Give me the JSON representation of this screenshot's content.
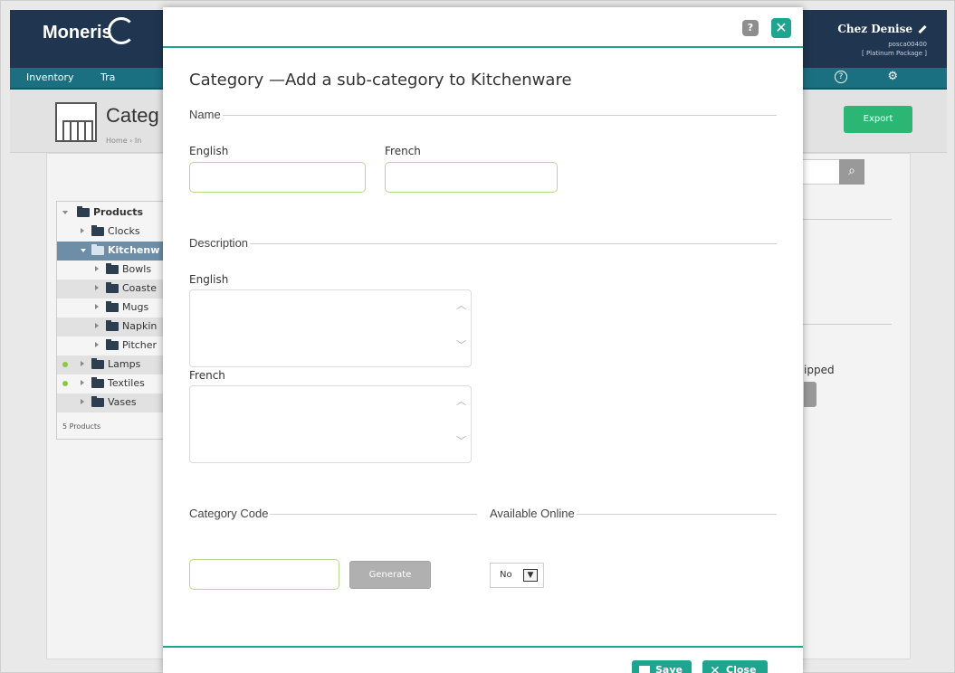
{
  "app": {
    "logo_text": "Moneris",
    "store_name": "Chez Denise",
    "store_code": "posca00400",
    "store_package": "[ Platinum Package ]"
  },
  "nav": {
    "items": [
      "Inventory",
      "Tra"
    ]
  },
  "page": {
    "title": "Categ",
    "breadcrumb": "Home  ›  In",
    "export_label": "Export"
  },
  "tree": {
    "items": [
      {
        "label": "Products",
        "level": 0
      },
      {
        "label": "Clocks",
        "level": 1
      },
      {
        "label": "Kitchenw",
        "level": 1
      },
      {
        "label": "Bowls",
        "level": 2
      },
      {
        "label": "Coaste",
        "level": 2
      },
      {
        "label": "Mugs",
        "level": 2
      },
      {
        "label": "Napkin",
        "level": 2
      },
      {
        "label": "Pitcher",
        "level": 2
      },
      {
        "label": "Lamps",
        "level": 1
      },
      {
        "label": "Textiles",
        "level": 1
      },
      {
        "label": "Vases",
        "level": 1
      }
    ],
    "footer": "5 Products"
  },
  "background": {
    "shipped_text": "ipped"
  },
  "modal": {
    "help_icon": "?",
    "close_icon": "✕",
    "title": "Category —Add a sub-category to Kitchenware",
    "name_section": "Name",
    "name_english_label": "English",
    "name_french_label": "French",
    "name_english_value": "",
    "name_french_value": "",
    "description_section": "Description",
    "desc_english_label": "English",
    "desc_french_label": "French",
    "desc_english_value": "",
    "desc_french_value": "",
    "category_code_section": "Category Code",
    "category_code_value": "",
    "generate_label": "Generate",
    "available_online_section": "Available Online",
    "available_online_value": "No",
    "save_label": "Save",
    "close_label": "Close"
  },
  "colors": {
    "accent": "#1fa58f",
    "input_border": "#b5d98a",
    "topbar": "#1f3550",
    "navbar": "#1a6f81",
    "export_button": "#2bb673"
  },
  "icons": [
    "help-icon",
    "close-icon",
    "search-icon",
    "warehouse-icon",
    "folder-icon",
    "save-icon",
    "edit-pencil-icon",
    "settings-icon"
  ]
}
